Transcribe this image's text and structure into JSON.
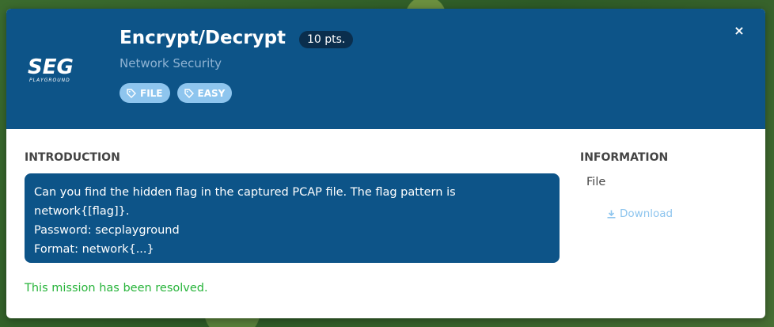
{
  "challenge": {
    "title": "Encrypt/Decrypt",
    "points": "10 pts.",
    "category": "Network Security",
    "tags": [
      "FILE",
      "EASY"
    ],
    "logo_text": "SEG",
    "logo_subtext": "PLAYGROUND"
  },
  "close_icon": "×",
  "introduction": {
    "heading": "INTRODUCTION",
    "lines": [
      "Can you find the hidden flag in the captured PCAP file. The flag pattern is",
      "network{[flag]}.",
      "Password: secplayground",
      "Format: network{...}"
    ]
  },
  "status": "This mission has been resolved.",
  "information": {
    "heading": "INFORMATION",
    "file_label": "File",
    "download_label": "Download"
  },
  "colors": {
    "header_bg": "#0d5488",
    "tag_bg": "#8ec5ee",
    "resolved": "#27b43a",
    "points_bg": "#0a2e4d"
  }
}
